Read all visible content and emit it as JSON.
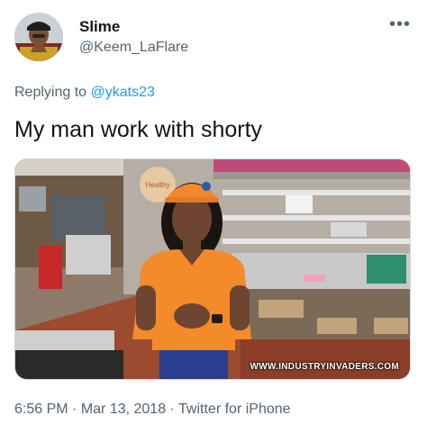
{
  "author": {
    "display_name": "Slime",
    "handle": "@Keem_LaFlare"
  },
  "more_icon": "more-horizontal-icon",
  "reply": {
    "prefix": "Replying to ",
    "mention": "@ykats23"
  },
  "tweet": {
    "text": "My man work with shorty"
  },
  "media": {
    "watermark": "WWW.INDUSTRYINVADERS.COM",
    "sign_text": "Healthy"
  },
  "footer": {
    "time": "6:56 PM",
    "date": "Mar 13, 2018",
    "source": "Twitter for iPhone",
    "separator": " · "
  }
}
